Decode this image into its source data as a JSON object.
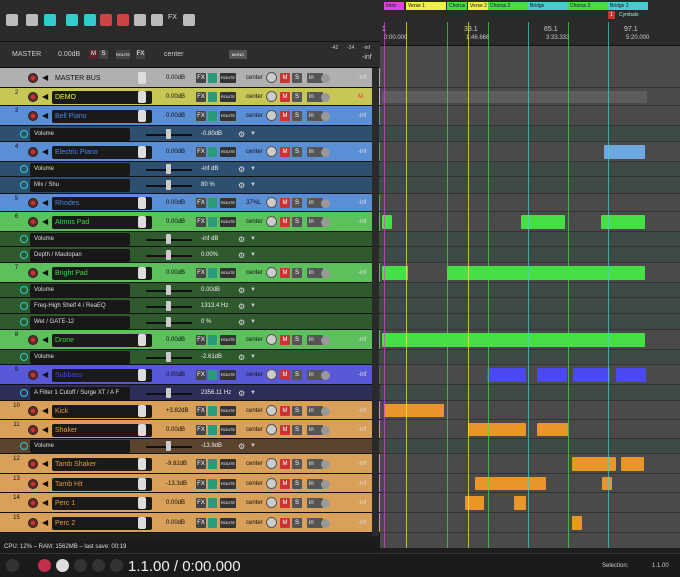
{
  "toolbar": {
    "icons": [
      "grid-icon",
      "metronome-icon",
      "loop-icon",
      "snap-icon",
      "marker-icon",
      "ripple-icon",
      "x-icon",
      "piano-icon",
      "tuner-icon",
      "fx-icon",
      "eye-icon"
    ],
    "fx_label": "FX"
  },
  "master": {
    "label": "MASTER",
    "volume": "0.00dB",
    "m": "M",
    "s": "S",
    "route": "ROUTE",
    "fx": "FX",
    "pan": "center",
    "mono": "MONO",
    "meter_scale": [
      "-42",
      "-24",
      "-inf"
    ],
    "meter_l": "-inf"
  },
  "tracks": [
    {
      "num": "",
      "name": "MASTER BUS",
      "volume": "0.00dB",
      "pan": "center",
      "m": "M",
      "s": "S",
      "in": "in",
      "inf": "-inf",
      "fx": "FX",
      "route": "ROUTE",
      "color": "#b0b0b0",
      "name_bg": "#b0b0b0"
    },
    {
      "num": "2",
      "name": "DEMO",
      "volume": "0.00dB",
      "pan": "center",
      "m": "M",
      "s": "S",
      "in": "in",
      "inf": "M",
      "fx": "FX",
      "route": "ROUTE",
      "color": "#c7c756",
      "name_bg": "#dede3d"
    },
    {
      "num": "3",
      "name": "Bell Piano",
      "volume": "0.00dB",
      "pan": "center",
      "m": "M",
      "s": "S",
      "in": "in",
      "inf": "-inf",
      "fx": "FX",
      "route": "ROUTE",
      "color": "#5a8fd6",
      "name_bg": "#4a86e0"
    },
    {
      "num": "4",
      "name": "Electric Piano",
      "volume": "0.00dB",
      "pan": "center",
      "m": "M",
      "s": "S",
      "in": "in",
      "inf": "-inf",
      "fx": "FX",
      "route": "ROUTE",
      "color": "#5a8fd6",
      "name_bg": "#4a86e0"
    },
    {
      "num": "5",
      "name": "Rhodes",
      "volume": "0.00dB",
      "pan": "37%L",
      "m": "M",
      "s": "S",
      "in": "in",
      "inf": "-inf",
      "fx": "FX",
      "route": "ROUTE",
      "color": "#5a8fd6",
      "name_bg": "#4a86e0"
    },
    {
      "num": "6",
      "name": "Atmos Pad",
      "volume": "0.00dB",
      "pan": "center",
      "m": "M",
      "s": "S",
      "in": "in",
      "inf": "-inf",
      "fx": "FX",
      "route": "ROUTE",
      "color": "#5cc05c",
      "name_bg": "#3fd83f"
    },
    {
      "num": "7",
      "name": "Bright Pad",
      "volume": "0.00dB",
      "pan": "center",
      "m": "M",
      "s": "S",
      "in": "in",
      "inf": "-inf",
      "fx": "FX",
      "route": "ROUTE",
      "color": "#5cc05c",
      "name_bg": "#3fd83f"
    },
    {
      "num": "8",
      "name": "Drone",
      "volume": "0.00dB",
      "pan": "center",
      "m": "M",
      "s": "S",
      "in": "in",
      "inf": "-inf",
      "fx": "FX",
      "route": "ROUTE",
      "color": "#5cc05c",
      "name_bg": "#3fd83f"
    },
    {
      "num": "9",
      "name": "Subbass",
      "volume": "0.00dB",
      "pan": "center",
      "m": "M",
      "s": "S",
      "in": "in",
      "inf": "-inf",
      "fx": "FX",
      "route": "ROUTE",
      "color": "#5959d8",
      "name_bg": "#4343e0"
    },
    {
      "num": "10",
      "name": "Kick",
      "volume": "+3.82dB",
      "pan": "center",
      "m": "M",
      "s": "S",
      "in": "in",
      "inf": "-inf",
      "fx": "FX",
      "route": "ROUTE",
      "color": "#d8a058",
      "name_bg": "#e09a3c"
    },
    {
      "num": "11",
      "name": "Shaker",
      "volume": "0.00dB",
      "pan": "center",
      "m": "M",
      "s": "S",
      "in": "in",
      "inf": "-inf",
      "fx": "FX",
      "route": "ROUTE",
      "color": "#d8a058",
      "name_bg": "#e09a3c"
    },
    {
      "num": "12",
      "name": "Tamb Shaker",
      "volume": "-9.82dB",
      "pan": "center",
      "m": "M",
      "s": "S",
      "in": "in",
      "inf": "-inf",
      "fx": "FX",
      "route": "ROUTE",
      "color": "#d8a058",
      "name_bg": "#e09a3c"
    },
    {
      "num": "13",
      "name": "Tamb Hit",
      "volume": "-13.3dB",
      "pan": "center",
      "m": "M",
      "s": "S",
      "in": "in",
      "inf": "-inf",
      "fx": "FX",
      "route": "ROUTE",
      "color": "#d8a058",
      "name_bg": "#e09a3c"
    },
    {
      "num": "14",
      "name": "Perc 1",
      "volume": "0.00dB",
      "pan": "center",
      "m": "M",
      "s": "S",
      "in": "in",
      "inf": "-inf",
      "fx": "FX",
      "route": "ROUTE",
      "color": "#d8a058",
      "name_bg": "#e09a3c"
    },
    {
      "num": "15",
      "name": "Perc 2",
      "volume": "0.00dB",
      "pan": "center",
      "m": "M",
      "s": "S",
      "in": "in",
      "inf": "-inf",
      "fx": "FX",
      "route": "ROUTE",
      "color": "#d8a058",
      "name_bg": "#e09a3c"
    }
  ],
  "envelopes": [
    {
      "name": "Volume",
      "value": "-0.80dB",
      "gear": "⚙",
      "arrow": "▼",
      "color": "#2e5070"
    },
    {
      "name": "Volume",
      "value": "-inf dB",
      "gear": "⚙",
      "arrow": "▼",
      "color": "#2e5070"
    },
    {
      "name": "Mix / Shu",
      "value": "80 %",
      "gear": "⚙",
      "arrow": "▼",
      "color": "#2e5070"
    },
    {
      "name": "Volume",
      "value": "-inf dB",
      "gear": "⚙",
      "arrow": "▼",
      "color": "#2e5a2e"
    },
    {
      "name": "Depth / Mautopan",
      "value": "0.00%",
      "gear": "⚙",
      "arrow": "▼",
      "color": "#2e5a2e"
    },
    {
      "name": "Volume",
      "value": "0.00dB",
      "gear": "⚙",
      "arrow": "▼",
      "color": "#2e5a2e"
    },
    {
      "name": "Freq-High Shelf 4 / ReaEQ",
      "value": "1313.4 Hz",
      "gear": "⚙",
      "arrow": "▼",
      "color": "#2e5a2e"
    },
    {
      "name": "Wet / GATE-12",
      "value": "0 %",
      "gear": "⚙",
      "arrow": "▼",
      "color": "#2e5a2e"
    },
    {
      "name": "Volume",
      "value": "-2.61dB",
      "gear": "⚙",
      "arrow": "▼",
      "color": "#2e5a2e"
    },
    {
      "name": "A Filter 1 Cutoff / Surge XT / A F",
      "value": "2356.11 Hz",
      "gear": "⚙",
      "arrow": "▼",
      "color": "#2e2e5a"
    },
    {
      "name": "Volume",
      "value": "-13.9dB",
      "gear": "⚙",
      "arrow": "▼",
      "color": "#5a442e"
    }
  ],
  "regions": [
    {
      "label": "Intro",
      "color": "#e040e0"
    },
    {
      "label": "Verse 1",
      "color": "#f0f040"
    },
    {
      "label": "Chorus 1",
      "color": "#40e040"
    },
    {
      "label": "Verse 2",
      "color": "#f0f040"
    },
    {
      "label": "Chorus 2",
      "color": "#40e040"
    },
    {
      "label": "Bridge",
      "color": "#40d0d0"
    },
    {
      "label": "Chorus 3",
      "color": "#40e040"
    },
    {
      "label": "Bridge 2",
      "color": "#40d0d0"
    }
  ],
  "marker": {
    "num": "1",
    "label": "Cymbals"
  },
  "ruler": [
    {
      "bar": "1",
      "time": "0:00.000"
    },
    {
      "bar": "33.1",
      "time": "1:46.666"
    },
    {
      "bar": "65.1",
      "time": "3:33.333"
    },
    {
      "bar": "97.1",
      "time": "5:20.000"
    }
  ],
  "status": {
    "text": "CPU: 12% – RAM: 1562MB – last save: 00:19"
  },
  "transport": {
    "timecode": "1.1.00 / 0:00.000",
    "selection_label": "Selection:",
    "selection_value": "1.1.00"
  }
}
